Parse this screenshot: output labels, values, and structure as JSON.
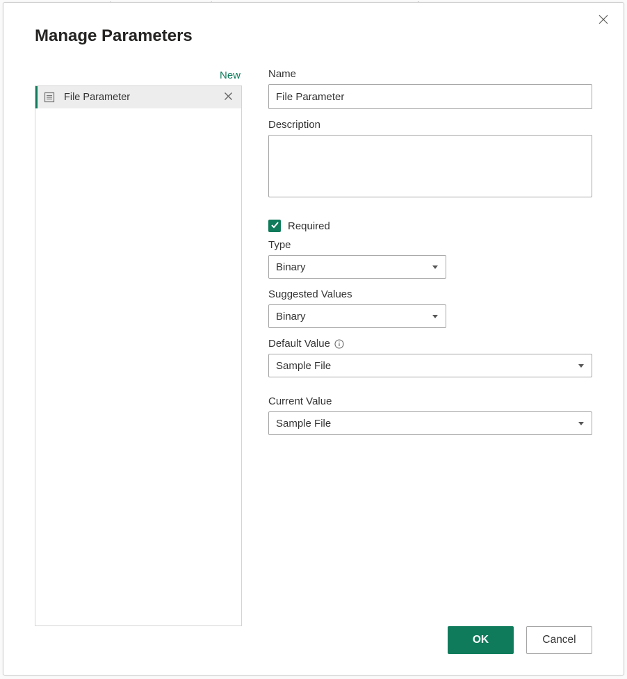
{
  "dialog": {
    "title": "Manage Parameters",
    "new_link": "New",
    "ok_label": "OK",
    "cancel_label": "Cancel"
  },
  "sidebar": {
    "items": [
      {
        "label": "File Parameter"
      }
    ]
  },
  "form": {
    "name_label": "Name",
    "name_value": "File Parameter",
    "description_label": "Description",
    "description_value": "",
    "required_label": "Required",
    "required_checked": true,
    "type_label": "Type",
    "type_value": "Binary",
    "suggested_label": "Suggested Values",
    "suggested_value": "Binary",
    "default_label": "Default Value",
    "default_value": "Sample File",
    "current_label": "Current Value",
    "current_value": "Sample File"
  }
}
